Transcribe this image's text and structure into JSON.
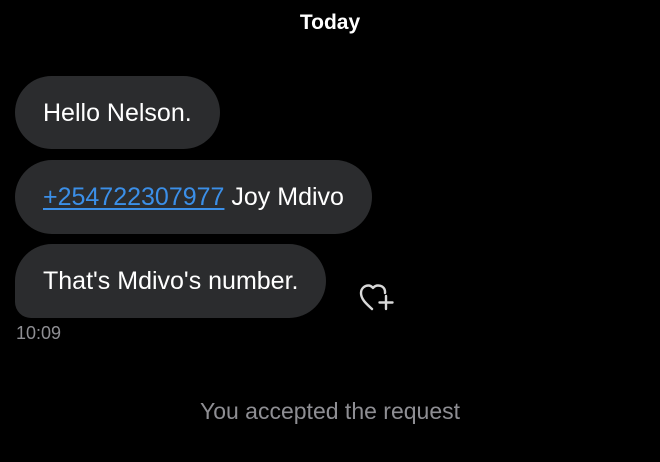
{
  "conversation": {
    "date_header": "Today",
    "messages": [
      {
        "text": "Hello Nelson."
      },
      {
        "phone": "+254722307977",
        "text": " Joy Mdivo"
      },
      {
        "text": "That's Mdivo's number."
      }
    ],
    "timestamp": "10:09",
    "system_note": "You accepted the request"
  },
  "icons": {
    "react": "heart-plus-icon"
  },
  "colors": {
    "background": "#000000",
    "bubble": "#2b2c2e",
    "link": "#3b8fe8",
    "muted_text": "#8e8e93"
  }
}
